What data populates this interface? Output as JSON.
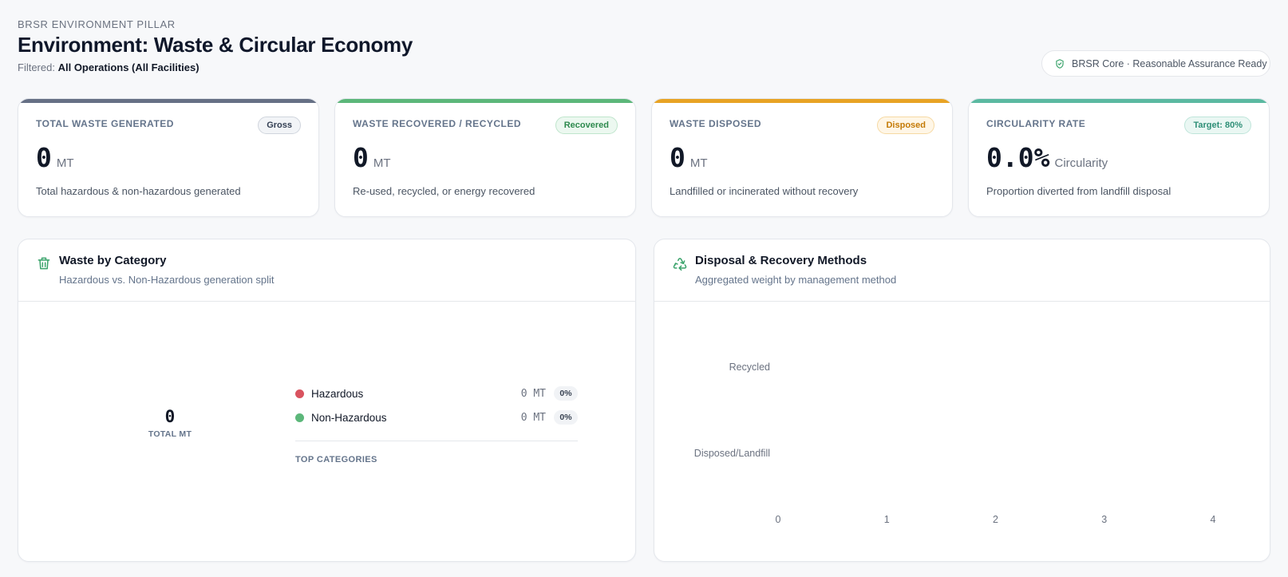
{
  "header": {
    "eyebrow": "BRSR ENVIRONMENT PILLAR",
    "title": "Environment: Waste & Circular Economy",
    "filter_label": "Filtered:",
    "filter_value": "All Operations (All Facilities)",
    "assurance_badge": "BRSR Core · Reasonable Assurance Ready",
    "assurance_icon": "shield-check-icon"
  },
  "kpis": [
    {
      "label": "TOTAL WASTE GENERATED",
      "badge": "Gross",
      "value": "0",
      "unit": "MT",
      "desc": "Total hazardous & non-hazardous generated",
      "accent": "#667085",
      "badge_bg": "#f2f4f7",
      "badge_fg": "#344054",
      "badge_border": "#d0d5dd"
    },
    {
      "label": "WASTE RECOVERED / RECYCLED",
      "badge": "Recovered",
      "value": "0",
      "unit": "MT",
      "desc": "Re-used, recycled, or energy recovered",
      "accent": "#5cb77a",
      "badge_bg": "#ecf8f0",
      "badge_fg": "#2e8a4e",
      "badge_border": "#bfe5cc"
    },
    {
      "label": "WASTE DISPOSED",
      "badge": "Disposed",
      "value": "0",
      "unit": "MT",
      "desc": "Landfilled or incinerated without recovery",
      "accent": "#e8a324",
      "badge_bg": "#fff6e6",
      "badge_fg": "#c47a06",
      "badge_border": "#f6d9a3"
    },
    {
      "label": "CIRCULARITY RATE",
      "badge": "Target: 80%",
      "value": "0.0%",
      "unit": "Circularity",
      "desc": "Proportion diverted from landfill disposal",
      "accent": "#5bb9a1",
      "badge_bg": "#eaf7f3",
      "badge_fg": "#2f8f77",
      "badge_border": "#bfe5da"
    }
  ],
  "category_panel": {
    "title": "Waste by Category",
    "subtitle": "Hazardous vs. Non-Hazardous generation split",
    "icon": "trash-icon",
    "total_value": "0",
    "total_caption": "TOTAL MT",
    "legend": [
      {
        "name": "Hazardous",
        "value": "0 MT",
        "pct": "0%",
        "color": "#d9535f"
      },
      {
        "name": "Non-Hazardous",
        "value": "0 MT",
        "pct": "0%",
        "color": "#5cb77a"
      }
    ],
    "top_categories_label": "TOP CATEGORIES"
  },
  "methods_panel": {
    "title": "Disposal & Recovery Methods",
    "subtitle": "Aggregated weight by management method",
    "icon": "recycle-icon"
  },
  "chart_data": {
    "type": "bar",
    "orientation": "horizontal",
    "categories": [
      "Recycled",
      "Disposed/Landfill"
    ],
    "values": [
      0,
      0
    ],
    "xlim": [
      0,
      4
    ],
    "xticks": [
      "0",
      "1",
      "2",
      "3",
      "4"
    ],
    "title": "",
    "xlabel": "",
    "ylabel": "",
    "grid": false
  }
}
